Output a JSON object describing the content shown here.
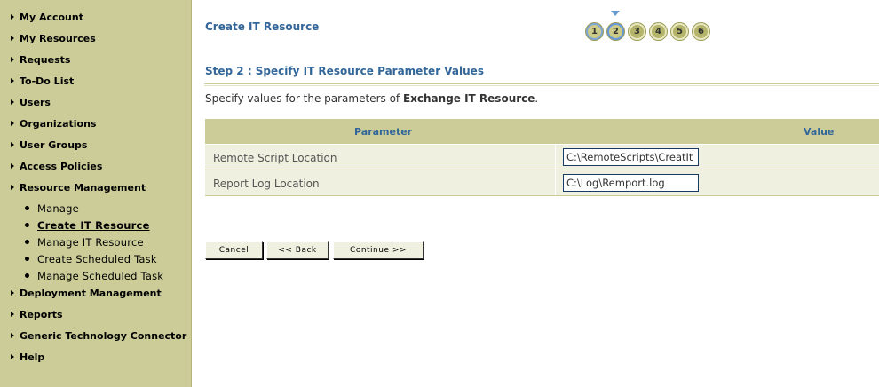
{
  "sidebar": {
    "items": [
      {
        "label": "My Account"
      },
      {
        "label": "My Resources"
      },
      {
        "label": "Requests"
      },
      {
        "label": "To-Do List"
      },
      {
        "label": "Users"
      },
      {
        "label": "Organizations"
      },
      {
        "label": "User Groups"
      },
      {
        "label": "Access Policies"
      },
      {
        "label": "Resource Management"
      },
      {
        "label": "Deployment Management"
      },
      {
        "label": "Reports"
      },
      {
        "label": "Generic Technology Connector"
      },
      {
        "label": "Help"
      }
    ],
    "subitems": [
      {
        "label": "Manage"
      },
      {
        "label": "Create IT Resource"
      },
      {
        "label": "Manage IT Resource"
      },
      {
        "label": "Create Scheduled Task"
      },
      {
        "label": "Manage Scheduled Task"
      }
    ]
  },
  "main": {
    "title": "Create IT Resource",
    "step_title": "Step 2 : Specify IT Resource Parameter Values",
    "desc_prefix": "Specify values for the parameters of ",
    "desc_resource": "Exchange IT Resource",
    "desc_suffix": "."
  },
  "steps": [
    "1",
    "2",
    "3",
    "4",
    "5",
    "6"
  ],
  "table": {
    "headers": {
      "parameter": "Parameter",
      "value": "Value"
    },
    "rows": [
      {
        "parameter": "Remote Script Location",
        "value": "C:\\RemoteScripts\\CreatIt"
      },
      {
        "parameter": "Report Log Location",
        "value": "C:\\Log\\Remport.log"
      }
    ]
  },
  "buttons": {
    "cancel": "Cancel",
    "back": "<< Back",
    "continue": "Continue >>"
  },
  "colors": {
    "sidebar_bg": "#cccc99",
    "heading_blue": "#336699",
    "row_bg": "#f0f0e0"
  }
}
